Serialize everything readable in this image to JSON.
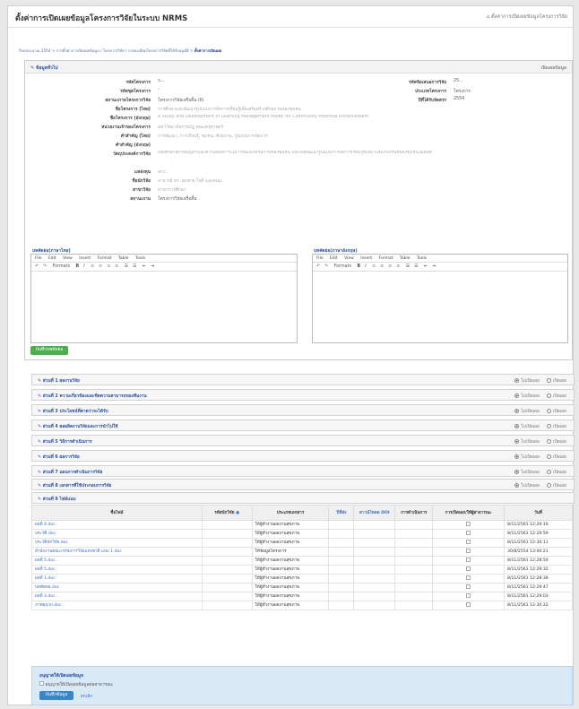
{
  "header": {
    "title": "ตั้งค่าการเปิดเผยข้อมูลโครงการวิจัยในระบบ NRMS",
    "breadcrumb_text": "ตั้งค่าการเปิดเผยข้อมูลโครงการวิจัย"
  },
  "breadcrumb": {
    "prefix": "ปีงบประมาณ 2554 > การตั้งค่าการเปิดเผยข้อมูล / โครงการวิจัย / รายละเอียดโครงการวิจัยที่ได้รับอนุมัติ > ",
    "current": "ตั้งค่าการเปิดเผย"
  },
  "info_panel": {
    "title": "ข้อมูลทั่วไป",
    "right_action": "เปิดเผยข้อมูล",
    "fields_left": [
      {
        "label": "รหัสโครงการ",
        "value": "5..."
      },
      {
        "label": "รหัสชุดโครงการ",
        "value": "-"
      },
      {
        "label": "สถานะภาพโครงการวิจัย",
        "value": "โครงการวิจัยเสร็จสิ้น (6)"
      },
      {
        "label": "ชื่อโครงการ (ไทย)",
        "value": "การศึกษาและพัฒนารูปแบบการจัดการเรียนรู้เพื่อเสริมสร้างศักยภาพของชุมชน"
      },
      {
        "label": "ชื่อโครงการ (อังกฤษ)",
        "value": "A Study and Development of Learning Management Model for Community Potential Enhancement"
      },
      {
        "label": "หน่วยงานเจ้าของโครงการ",
        "value": "มหาวิทยาลัยราชภัฏ คณะครุศาสตร์"
      },
      {
        "label": "คำสำคัญ (ไทย)",
        "value": "การพัฒนา, การเรียนรู้, ชุมชน, ศักยภาพ, รูปแบบการจัดการ"
      },
      {
        "label": "คำสำคัญ (อังกฤษ)",
        "value": ""
      },
      {
        "label": "วัตถุประสงค์การวิจัย",
        "value": "เพื่อศึกษาสภาพปัญหาและความต้องการในการพัฒนาศักยภาพของชุมชน และเพื่อพัฒนารูปแบบการจัดการเรียนรู้ที่เหมาะสมกับบริบทของชุมชนในพื้นที่"
      },
      {
        "label": "แหล่งทุน",
        "value": "สกว."
      },
      {
        "label": "ชื่อนักวิจัย",
        "value": "อาจารย์ ดร. สมชาย ใจดี และคณะ"
      },
      {
        "label": "สาขาวิจัย",
        "value": "สาขาการศึกษา"
      },
      {
        "label": "สถานะงาน",
        "value": "โครงการวิจัยเสร็จสิ้น"
      }
    ],
    "fields_right": [
      {
        "label": "รหัสข้อเสนอการวิจัย",
        "value": "25..."
      },
      {
        "label": "ประเภทโครงการ",
        "value": "โครงการ"
      },
      {
        "label": "ปีที่ได้รับจัดสรร",
        "value": "2554"
      }
    ],
    "editor_th_label": "บทคัดย่อ(ภาษาไทย)",
    "editor_en_label": "บทคัดย่อ(ภาษาอังกฤษ)",
    "editor_menu": [
      "File",
      "Edit",
      "View",
      "Insert",
      "Format",
      "Table",
      "Tools"
    ],
    "editor_formats": "Formats",
    "save_button": "บันทึกบทคัดย่อ"
  },
  "sections": [
    {
      "title": "ส่วนที่ 1 ผลงานวิจัย",
      "opt_on": "ไม่เปิดเผย",
      "opt_off": "เปิดเผย"
    },
    {
      "title": "ส่วนที่ 2 ความเกี่ยวข้องและขีดความสามารถของทีมงาน",
      "opt_on": "ไม่เปิดเผย",
      "opt_off": "เปิดเผย"
    },
    {
      "title": "ส่วนที่ 3 ประโยชน์ที่คาดว่าจะได้รับ",
      "opt_on": "ไม่เปิดเผย",
      "opt_off": "เปิดเผย"
    },
    {
      "title": "ส่วนที่ 4 ผลผลิตงานวิจัยและการนำไปใช้",
      "opt_on": "ไม่เปิดเผย",
      "opt_off": "เปิดเผย"
    },
    {
      "title": "ส่วนที่ 5 วิธีการดำเนินการ",
      "opt_on": "ไม่เปิดเผย",
      "opt_off": "เปิดเผย"
    },
    {
      "title": "ส่วนที่ 6 ผลการวิจัย",
      "opt_on": "ไม่เปิดเผย",
      "opt_off": "เปิดเผย"
    },
    {
      "title": "ส่วนที่ 7 แผนการดำเนินการวิจัย",
      "opt_on": "ไม่เปิดเผย",
      "opt_off": "เปิดเผย"
    },
    {
      "title": "ส่วนที่ 8 เอกสารที่ใช้ประกอบการวิจัย",
      "opt_on": "ไม่เปิดเผย",
      "opt_off": "เปิดเผย"
    }
  ],
  "files_section": {
    "title": "ส่วนที่ 9 ไฟล์แนบ",
    "columns": [
      "ชื่อไฟล์",
      "รหัสนักวิจัย",
      "ประเภทเอกสาร",
      "ปีที่ส่ง",
      "ดาวน์โหลด DOI",
      "การดำเนินการ",
      "การเปิดเผย/ให้ผู้สาธารณะ",
      "วันที่"
    ],
    "rows": [
      {
        "name": "ผลที่ 4.doc",
        "type": "ให้ผู้ทำงานผลงานสุขภาพ",
        "date": "8/11/2561 12:29:16"
      },
      {
        "name": "ประวัติ.doc",
        "type": "ให้ผู้ทำงานผลงานสุขภาพ",
        "date": "8/11/2561 12:29:59"
      },
      {
        "name": "ประวัตินักวิจัย.doc",
        "type": "ให้ผู้ทำงานผลงานสุขภาพ",
        "date": "8/11/2561 12:30:11"
      },
      {
        "name": "สำนักงานคณะกรรมการวิจัยแห่งชาติ แบบ 1.doc",
        "type": "ให้ข้อมูลโครงการ",
        "date": "30/8/2554 13:00:21"
      },
      {
        "name": "ผลที่ 5.doc",
        "type": "ให้ผู้ทำงานผลงานสุขภาพ",
        "date": "8/11/2561 12:28:50"
      },
      {
        "name": "ผลที่ 5.doc",
        "type": "ให้ผู้ทำงานผลงานสุขภาพ",
        "date": "8/11/2561 12:29:32"
      },
      {
        "name": "ผลที่ 1.doc",
        "type": "ให้ผู้ทำงานผลงานสุขภาพ",
        "date": "8/11/2561 12:28:38"
      },
      {
        "name": "บทคัดย่อ.doc",
        "type": "ให้ผู้ทำงานผลงานสุขภาพ",
        "date": "8/11/2561 12:29:47"
      },
      {
        "name": "ผลที่ 3.doc",
        "type": "ให้ผู้ทำงานผลงานสุขภาพ",
        "date": "8/11/2561 12:29:03"
      },
      {
        "name": "ภาคผนวก.doc",
        "type": "ให้ผู้ทำงานผลงานสุขภาพ",
        "date": "8/11/2561 12:30:22"
      }
    ]
  },
  "footer": {
    "title": "อนุญาตให้เปิดเผยข้อมูล",
    "checkbox_label": "อนุญาตให้เปิดเผยข้อมูลต่อสาธารณะ",
    "save_button": "บันทึกข้อมูล",
    "cancel_link": "ยกเลิก"
  },
  "colors": {
    "accent": "#2a4f9a",
    "save": "#4cae4c",
    "primary": "#3a86c8"
  }
}
